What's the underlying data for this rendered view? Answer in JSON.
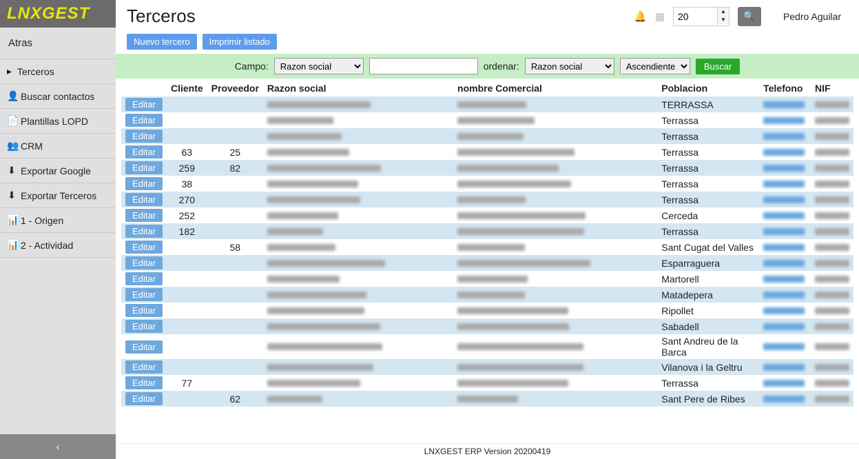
{
  "brand": "LNXGEST",
  "page_title": "Terceros",
  "back_label": "Atras",
  "nav": [
    {
      "icon": "",
      "label": "Terceros",
      "active": true
    },
    {
      "icon": "👤",
      "label": "Buscar contactos"
    },
    {
      "icon": "📄",
      "label": "Plantillas LOPD"
    },
    {
      "icon": "👥",
      "label": "CRM"
    },
    {
      "icon": "⬇",
      "label": "Exportar Google"
    },
    {
      "icon": "⬇",
      "label": "Exportar Terceros"
    },
    {
      "icon": "📊",
      "label": "1 - Origen"
    },
    {
      "icon": "📊",
      "label": "2 - Actividad"
    }
  ],
  "top": {
    "number_value": "20",
    "user": "Pedro Aguilar"
  },
  "actions": {
    "nuevo": "Nuevo tercero",
    "imprimir": "Imprimir listado"
  },
  "filter": {
    "campo_label": "Campo:",
    "campo_value": "Razon social",
    "orden_label": "ordenar:",
    "orden_value": "Razon social",
    "dir_value": "Ascendiente",
    "buscar_label": "Buscar"
  },
  "columns": {
    "cliente": "Cliente",
    "proveedor": "Proveedor",
    "razon": "Razon social",
    "nombrec": "nombre Comercial",
    "poblacion": "Poblacion",
    "telefono": "Telefono",
    "nif": "NIF"
  },
  "edit_label": "Editar",
  "rows": [
    {
      "cli": "",
      "prov": "",
      "pob": "TERRASSA"
    },
    {
      "cli": "",
      "prov": "",
      "pob": "Terrassa"
    },
    {
      "cli": "",
      "prov": "",
      "pob": "Terrassa"
    },
    {
      "cli": "63",
      "prov": "25",
      "pob": "Terrassa"
    },
    {
      "cli": "259",
      "prov": "82",
      "pob": "Terrassa"
    },
    {
      "cli": "38",
      "prov": "",
      "pob": "Terrassa"
    },
    {
      "cli": "270",
      "prov": "",
      "pob": "Terrassa"
    },
    {
      "cli": "252",
      "prov": "",
      "pob": "Cerceda"
    },
    {
      "cli": "182",
      "prov": "",
      "pob": "Terrassa"
    },
    {
      "cli": "",
      "prov": "58",
      "pob": "Sant Cugat del Valles"
    },
    {
      "cli": "",
      "prov": "",
      "pob": "Esparraguera"
    },
    {
      "cli": "",
      "prov": "",
      "pob": "Martorell"
    },
    {
      "cli": "",
      "prov": "",
      "pob": "Matadepera"
    },
    {
      "cli": "",
      "prov": "",
      "pob": "Ripollet"
    },
    {
      "cli": "",
      "prov": "",
      "pob": "Sabadell"
    },
    {
      "cli": "",
      "prov": "",
      "pob": "Sant Andreu de la Barca"
    },
    {
      "cli": "",
      "prov": "",
      "pob": "Vilanova i la Geltru"
    },
    {
      "cli": "77",
      "prov": "",
      "pob": "Terrassa"
    },
    {
      "cli": "",
      "prov": "62",
      "pob": "Sant Pere de Ribes"
    }
  ],
  "footer": "LNXGEST ERP Version 20200419"
}
